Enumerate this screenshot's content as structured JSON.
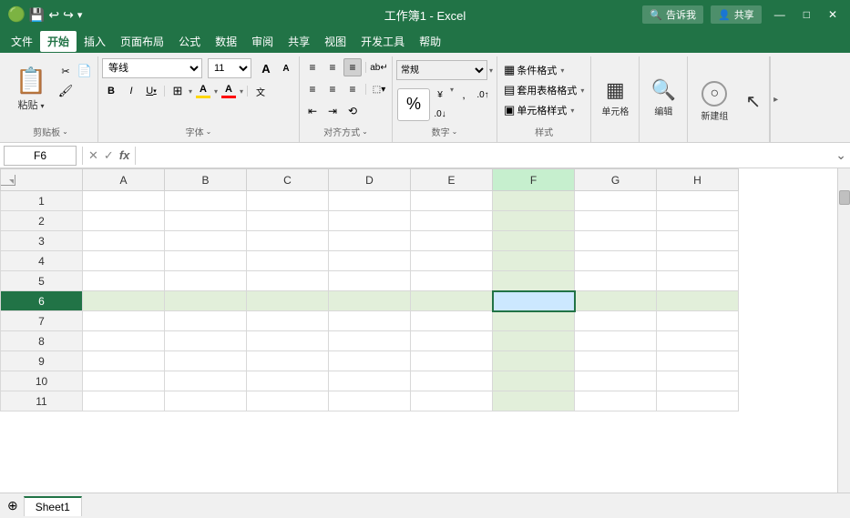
{
  "titlebar": {
    "title": "工作簿1 - Excel",
    "quick_access": [
      "save",
      "undo",
      "redo"
    ],
    "right_actions": [
      "tell_me",
      "share"
    ],
    "tell_me_placeholder": "告诉我",
    "share_label": "共享"
  },
  "menubar": {
    "items": [
      "文件",
      "开始",
      "插入",
      "页面布局",
      "公式",
      "数据",
      "审阅",
      "共享",
      "视图",
      "开发工具",
      "帮助"
    ],
    "active": "开始"
  },
  "ribbon": {
    "groups": [
      {
        "name": "clipboard",
        "label": "剪贴板",
        "buttons": [
          {
            "id": "paste",
            "label": "粘贴",
            "icon": "📋",
            "size": "large"
          },
          {
            "id": "cut",
            "label": "",
            "icon": "✂",
            "size": "small"
          },
          {
            "id": "copy",
            "label": "",
            "icon": "📄",
            "size": "small"
          },
          {
            "id": "format-painter",
            "label": "",
            "icon": "🖌",
            "size": "small"
          }
        ]
      },
      {
        "name": "font",
        "label": "字体",
        "font_name": "等线",
        "font_size": "11",
        "bold": "B",
        "italic": "I",
        "underline": "U",
        "grow": "A",
        "shrink": "A",
        "border": "⊞",
        "fill_color": "A",
        "font_color": "A"
      },
      {
        "name": "alignment",
        "label": "对齐方式",
        "buttons": [
          "≡top-left",
          "≡top-center",
          "≡top-right",
          "≡mid-left",
          "≡mid-center",
          "≡mid-right",
          "≡bottom-left",
          "≡bottom-center",
          "≡bottom-right"
        ]
      },
      {
        "name": "number",
        "label": "数字",
        "format": "%",
        "label_text": "数字"
      },
      {
        "name": "styles",
        "label": "样式",
        "items": [
          "条件格式",
          "套用表格格式",
          "单元格样式"
        ]
      },
      {
        "name": "cells",
        "label": "单元格",
        "buttons": [
          {
            "label": "单元格",
            "icon": "▦"
          }
        ]
      },
      {
        "name": "editing",
        "label": "",
        "buttons": [
          {
            "label": "编辑",
            "icon": "🔍"
          }
        ]
      },
      {
        "name": "outline",
        "label": "",
        "buttons": [
          {
            "label": "新建组",
            "icon": "○"
          }
        ]
      }
    ]
  },
  "formula_bar": {
    "cell_ref": "F6",
    "cancel_icon": "✕",
    "confirm_icon": "✓",
    "fx_icon": "fx",
    "formula_value": ""
  },
  "spreadsheet": {
    "columns": [
      "A",
      "B",
      "C",
      "D",
      "E",
      "F",
      "G",
      "H"
    ],
    "rows": [
      1,
      2,
      3,
      4,
      5,
      6,
      7,
      8,
      9,
      10,
      11
    ],
    "selected_cell": "F6",
    "selected_row": 6,
    "selected_col": "F"
  }
}
